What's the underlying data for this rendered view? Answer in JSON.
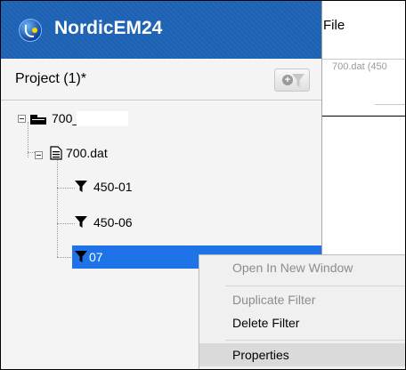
{
  "app": {
    "title": "NordicEM24",
    "brand_color": "#1e62b4"
  },
  "project": {
    "label": "Project (1)*",
    "add_filter_icon": "filter-add-icon"
  },
  "tree": {
    "root": {
      "label": "700_",
      "icon": "folder-icon"
    },
    "file": {
      "label": "700.dat",
      "icon": "document-icon"
    },
    "filters": [
      {
        "label": "450-01",
        "icon": "filter-icon",
        "selected": false
      },
      {
        "label": "450-06",
        "icon": "filter-icon",
        "selected": false
      },
      {
        "label": "07",
        "icon": "filter-icon",
        "selected": true
      }
    ],
    "selection_color": "#1e73e8"
  },
  "right_panel": {
    "menu_label": "File",
    "tab_caption": "700.dat (450"
  },
  "context_menu": {
    "items": [
      {
        "label": "Open In New Window",
        "enabled": false
      },
      {
        "label": "Duplicate Filter",
        "enabled": false
      },
      {
        "label": "Delete Filter",
        "enabled": true
      },
      {
        "label": "Properties",
        "enabled": true,
        "hovered": true
      }
    ]
  }
}
